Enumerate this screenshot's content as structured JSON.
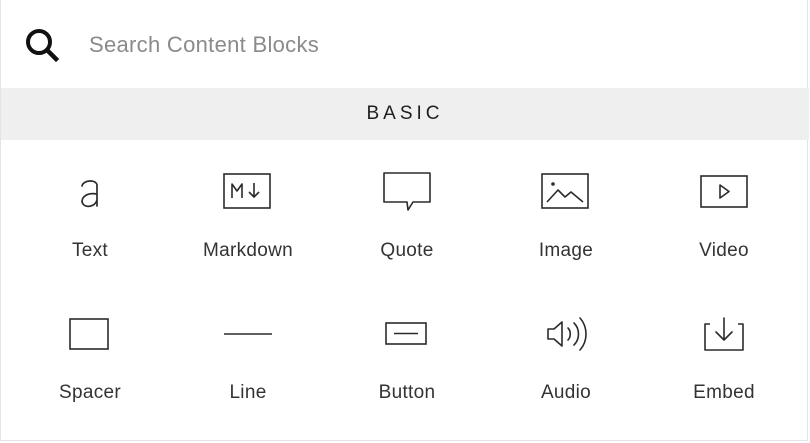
{
  "search": {
    "placeholder": "Search Content Blocks",
    "value": ""
  },
  "section": {
    "title": "BASIC"
  },
  "blocks": [
    {
      "label": "Text",
      "icon": "text-a-icon"
    },
    {
      "label": "Markdown",
      "icon": "markdown-icon"
    },
    {
      "label": "Quote",
      "icon": "quote-speech-bubble-icon"
    },
    {
      "label": "Image",
      "icon": "image-icon"
    },
    {
      "label": "Video",
      "icon": "video-play-icon"
    },
    {
      "label": "Spacer",
      "icon": "spacer-rectangle-icon"
    },
    {
      "label": "Line",
      "icon": "line-icon"
    },
    {
      "label": "Button",
      "icon": "button-icon"
    },
    {
      "label": "Audio",
      "icon": "speaker-icon"
    },
    {
      "label": "Embed",
      "icon": "embed-download-icon"
    }
  ],
  "colors": {
    "text": "#333333",
    "header_bg": "#efefef",
    "placeholder": "#8a8a8a",
    "icon_stroke": "#2b2b2b"
  }
}
